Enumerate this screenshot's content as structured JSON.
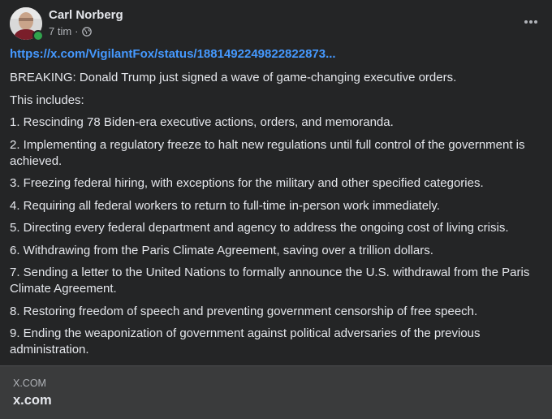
{
  "post": {
    "author": "Carl Norberg",
    "time": "7 tim",
    "separator": "·",
    "privacy_icon": "globe-icon",
    "more_icon": "more-horizontal-icon",
    "online_status_color": "#31a24c"
  },
  "content": {
    "link": "https://x.com/VigilantFox/status/1881492249822822873...",
    "paragraphs": [
      "BREAKING: Donald Trump just signed a wave of game-changing executive orders.",
      "This includes:",
      "1. Rescinding 78 Biden-era executive actions, orders, and memoranda.",
      "2. Implementing a regulatory freeze to halt new regulations until full control of the government is achieved.",
      "3. Freezing federal hiring, with exceptions for the military and other specified categories.",
      "4. Requiring all federal workers to return to full-time in-person work immediately.",
      "5. Directing every federal department and agency to address the ongoing cost of living crisis.",
      "6. Withdrawing from the Paris Climate Agreement, saving over a trillion dollars.",
      "7. Sending a letter to the United Nations to formally announce the U.S. withdrawal from the Paris Climate Agreement.",
      "8. Restoring freedom of speech and preventing government censorship of free speech.",
      "9. Ending the weaponization of government against political adversaries of the previous administration."
    ]
  },
  "link_card": {
    "domain": "X.COM",
    "title": "x.com"
  }
}
